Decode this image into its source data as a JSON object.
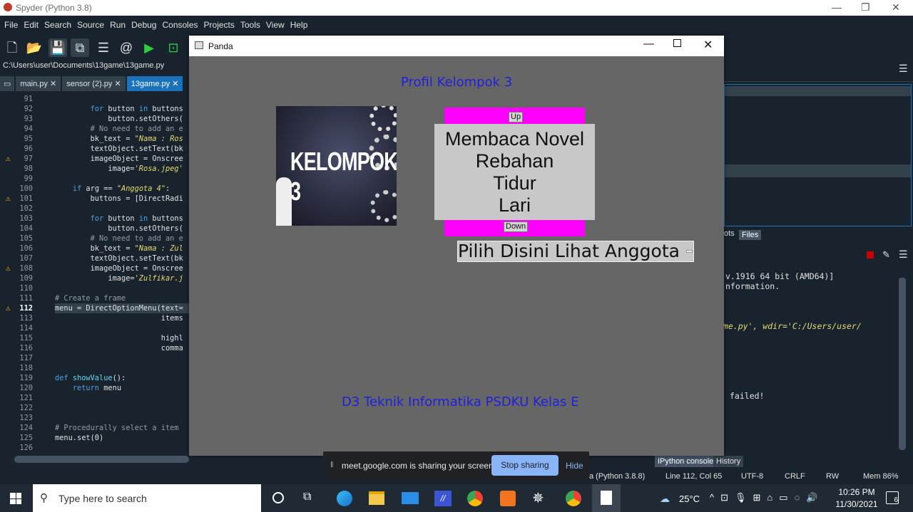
{
  "app": {
    "title": "Spyder (Python 3.8)"
  },
  "menubar": [
    "File",
    "Edit",
    "Search",
    "Source",
    "Run",
    "Debug",
    "Consoles",
    "Projects",
    "Tools",
    "View",
    "Help"
  ],
  "path": "C:\\Users\\user\\Documents\\13game\\13game.py",
  "tabs": [
    "main.py",
    "sensor (2).py",
    "13game.py"
  ],
  "editor": {
    "lines": [
      {
        "n": "91",
        "code": ""
      },
      {
        "n": "92",
        "code": "        for button in buttons"
      },
      {
        "n": "93",
        "code": "            button.setOthers("
      },
      {
        "n": "94",
        "code": "        # No need to add an e"
      },
      {
        "n": "95",
        "code": "        bk_text = \"Nama : Ros"
      },
      {
        "n": "96",
        "code": "        textObject.setText(bk"
      },
      {
        "n": "97",
        "code": "        imageObject = Onscree"
      },
      {
        "n": "98",
        "code": "            image='Rosa.jpeg'"
      },
      {
        "n": "99",
        "code": ""
      },
      {
        "n": "100",
        "code": "    if arg == \"Anggota 4\":"
      },
      {
        "n": "101",
        "code": "        buttons = [DirectRadi"
      },
      {
        "n": "102",
        "code": ""
      },
      {
        "n": "103",
        "code": "        for button in buttons"
      },
      {
        "n": "104",
        "code": "            button.setOthers("
      },
      {
        "n": "105",
        "code": "        # No need to add an e"
      },
      {
        "n": "106",
        "code": "        bk_text = \"Nama : Zul"
      },
      {
        "n": "107",
        "code": "        textObject.setText(bk"
      },
      {
        "n": "108",
        "code": "        imageObject = Onscree"
      },
      {
        "n": "109",
        "code": "            image='Zulfikar.j"
      },
      {
        "n": "110",
        "code": ""
      },
      {
        "n": "111",
        "code": "# Create a frame"
      },
      {
        "n": "112",
        "code": "menu = DirectOptionMenu(text="
      },
      {
        "n": "113",
        "code": "                        items"
      },
      {
        "n": "114",
        "code": ""
      },
      {
        "n": "115",
        "code": "                        highl"
      },
      {
        "n": "116",
        "code": "                        comma"
      },
      {
        "n": "117",
        "code": ""
      },
      {
        "n": "118",
        "code": ""
      },
      {
        "n": "119",
        "code": "def showValue():"
      },
      {
        "n": "120",
        "code": "    return menu"
      },
      {
        "n": "121",
        "code": ""
      },
      {
        "n": "122",
        "code": ""
      },
      {
        "n": "123",
        "code": ""
      },
      {
        "n": "124",
        "code": "# Procedurally select a item"
      },
      {
        "n": "125",
        "code": "menu.set(0)"
      },
      {
        "n": "126",
        "code": ""
      }
    ],
    "warning_lines": [
      "97",
      "101",
      "108",
      "112"
    ]
  },
  "right_pane": {
    "tabs": [
      "ots",
      "Files"
    ],
    "console_lines": [
      "v.1916 64 bit (AMD64)]",
      "nformation.",
      "ame.py', wdir='C:/Users/user/",
      "failed!"
    ],
    "bottom_tabs": [
      "IPython console",
      "History"
    ]
  },
  "panda": {
    "window_title": "Panda",
    "heading": "Profil Kelompok 3",
    "image_text": "KELOMPOK 3",
    "scroll_up": "Up",
    "scroll_down": "Down",
    "menu_items": [
      "Membaca Novel",
      "Rebahan",
      "Tidur",
      "Lari"
    ],
    "option_menu": "Pilih Disini Lihat Anggota",
    "footer": "D3 Teknik Informatika PSDKU Kelas E"
  },
  "share_bar": {
    "message": "meet.google.com is sharing your screen.",
    "stop": "Stop sharing",
    "hide": "Hide"
  },
  "statusbar": {
    "interpreter": "a (Python 3.8.8)",
    "position": "Line 112, Col 65",
    "encoding": "UTF-8",
    "eol": "CRLF",
    "rw": "RW",
    "mem": "Mem 86%"
  },
  "taskbar": {
    "search_placeholder": "Type here to search",
    "weather": "25°C",
    "time": "10:26 PM",
    "date": "11/30/2021",
    "notif_count": "6"
  },
  "colors": {
    "magenta": "#ff00ff",
    "heading_blue": "#1f1fe0",
    "accent": "#1a72bb"
  }
}
